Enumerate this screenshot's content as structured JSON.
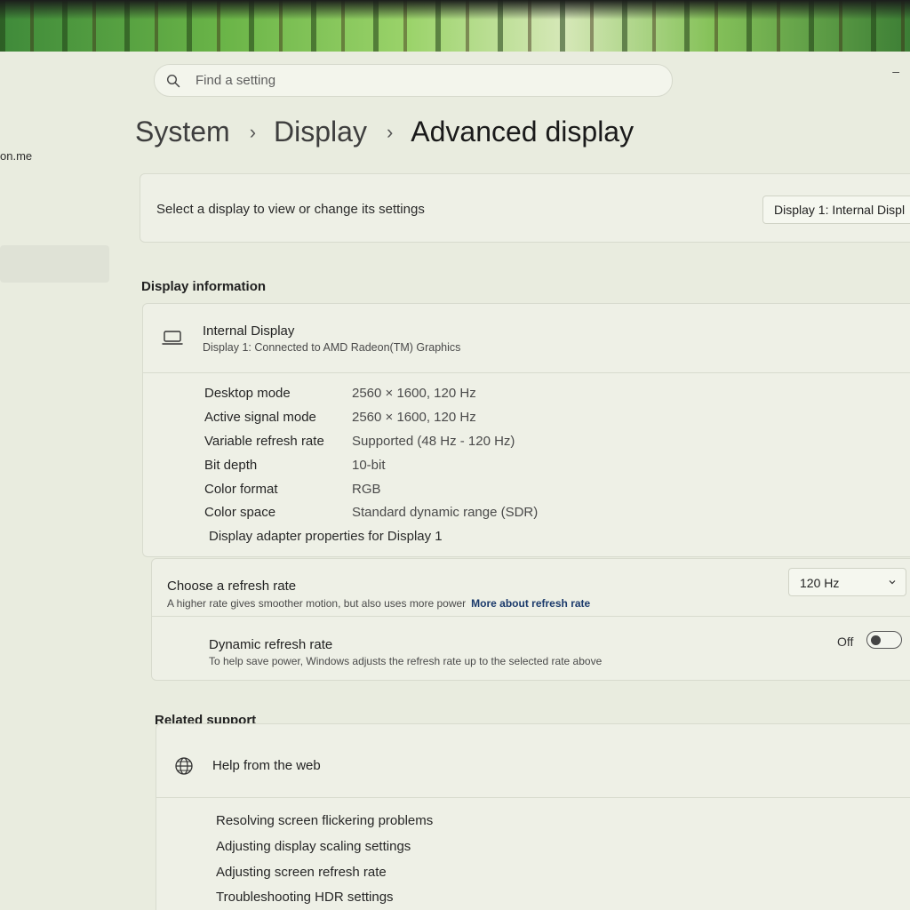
{
  "search": {
    "placeholder": "Find a setting"
  },
  "sidebar": {
    "account_fragment": "on.me"
  },
  "window_controls": {
    "minimize": "–"
  },
  "breadcrumb": [
    "System",
    "Display",
    "Advanced display"
  ],
  "select_display": {
    "label": "Select a display to view or change its settings",
    "dropdown_value": "Display 1: Internal Displ"
  },
  "display_information": {
    "section_title": "Display information",
    "name": "Internal Display",
    "subtitle": "Display 1: Connected to AMD Radeon(TM) Graphics",
    "specs": [
      {
        "label": "Desktop mode",
        "value": "2560 × 1600, 120 Hz"
      },
      {
        "label": "Active signal mode",
        "value": "2560 × 1600, 120 Hz"
      },
      {
        "label": "Variable refresh rate",
        "value": "Supported (48 Hz - 120 Hz)"
      },
      {
        "label": "Bit depth",
        "value": "10-bit"
      },
      {
        "label": "Color format",
        "value": "RGB"
      },
      {
        "label": "Color space",
        "value": "Standard dynamic range (SDR)"
      }
    ],
    "adapter_link": "Display adapter properties for Display 1"
  },
  "refresh_rate": {
    "title": "Choose a refresh rate",
    "subtitle": "A higher rate gives smoother motion, but also uses more power",
    "link": "More about refresh rate",
    "selected": "120 Hz"
  },
  "dynamic_refresh": {
    "title": "Dynamic refresh rate",
    "subtitle": "To help save power, Windows adjusts the refresh rate up to the selected rate above",
    "state_label": "Off"
  },
  "related_support": {
    "section_title": "Related support",
    "help_title": "Help from the web",
    "links": [
      "Resolving screen flickering problems",
      "Adjusting display scaling settings",
      "Adjusting screen refresh rate",
      "Troubleshooting HDR settings"
    ]
  }
}
